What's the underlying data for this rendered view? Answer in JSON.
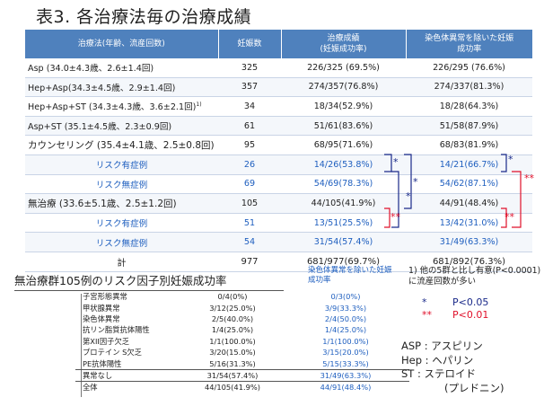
{
  "title": "表3. 各治療法毎の治療成績",
  "table": {
    "headers": [
      "治療法(年齢、流産回数)",
      "妊娠数",
      "治療成績\n(妊娠成功率)",
      "染色体異常を除いた妊娠成功率"
    ],
    "rows": [
      {
        "label": "Asp (34.0±4.3歳、2.6±1.4回)",
        "n": "325",
        "rate": "226/325 (69.5%)",
        "rate2": "226/295 (76.6%)",
        "sub": false
      },
      {
        "label": "Hep+Asp(34.3±4.5歳、2.9±1.4回)",
        "n": "357",
        "rate": "274/357(76.8%)",
        "rate2": "274/337(81.3%)",
        "sub": false
      },
      {
        "label": "Hep+Asp+ST (34.3±4.3歳、3.6±2.1回)",
        "sup": "1)",
        "n": "34",
        "rate": "18/34(52.9%)",
        "rate2": "18/28(64.3%)",
        "sub": false
      },
      {
        "label": "Asp+ST (35.1±4.5歳、2.3±0.9回)",
        "n": "61",
        "rate": "51/61(83.6%)",
        "rate2": "51/58(87.9%)",
        "sub": false
      },
      {
        "label": "カウンセリング (35.4±4.1歳、2.5±0.8回)",
        "n": "95",
        "rate": "68/95(71.6%)",
        "rate2": "68/83(81.9%)",
        "sub": false
      },
      {
        "label": "リスク有症例",
        "n": "26",
        "rate": "14/26(53.8%)",
        "rate2": "14/21(66.7%)",
        "sub": true
      },
      {
        "label": "リスク無症例",
        "n": "69",
        "rate": "54/69(78.3%)",
        "rate2": "54/62(87.1%)",
        "sub": true
      },
      {
        "label": "無治療 (33.6±5.1歳、2.5±1.2回)",
        "n": "105",
        "rate": "44/105(41.9%)",
        "rate2": "44/91(48.4%)",
        "sub": false
      },
      {
        "label": "リスク有症例",
        "n": "51",
        "rate": "13/51(25.5%)",
        "rate2": "13/42(31.0%)",
        "sub": true
      },
      {
        "label": "リスク無症例",
        "n": "54",
        "rate": "31/54(57.4%)",
        "rate2": "31/49(63.3%)",
        "sub": true
      },
      {
        "label": "計",
        "n": "977",
        "rate": "681/977(69.7%)",
        "rate2": "681/892(76.3%)",
        "sub": false
      }
    ]
  },
  "marks": {
    "single": "*",
    "double": "**"
  },
  "risk": {
    "title": "無治療群105例のリスク因子別妊娠成功率",
    "chrom_header": "染色体異常を除いた妊娠成功率",
    "rows": [
      {
        "factor": "子宮形態異常",
        "v1": "0/4(0%)",
        "v2": "0/3(0%)"
      },
      {
        "factor": "甲状腺異常",
        "v1": "3/12(25.0%)",
        "v2": "3/9(33.3%)"
      },
      {
        "factor": "染色体異常",
        "v1": "2/5(40.0%)",
        "v2": "2/4(50.0%)"
      },
      {
        "factor": "抗リン脂質抗体陽性",
        "v1": "1/4(25.0%)",
        "v2": "1/4(25.0%)"
      },
      {
        "factor": "第XII因子欠乏",
        "v1": "1/1(100.0%)",
        "v2": "1/1(100.0%)"
      },
      {
        "factor": "プロテイン S欠乏",
        "v1": "3/20(15.0%)",
        "v2": "3/15(20.0%)"
      },
      {
        "factor": "PE抗体陽性",
        "v1": "5/16(31.3%)",
        "v2": "5/15(33.3%)"
      },
      {
        "factor": "異常なし",
        "v1": "31/54(57.4%)",
        "v2": "31/49(63.3%)"
      },
      {
        "factor": "全体",
        "v1": "44/105(41.9%)",
        "v2": "44/91(48.4%)"
      }
    ]
  },
  "notes": {
    "footnote": "1) 他の5群と比し有意(P<0.0001)に流産回数が多い",
    "sig1_star": "*",
    "sig1_text": "P<0.05",
    "sig2_star": "**",
    "sig2_text": "P<0.01",
    "abbr": [
      "ASP : アスピリン",
      "Hep : ヘパリン",
      "ST : ステロイド",
      "(プレドニン)"
    ]
  },
  "colors": {
    "header_bg": "#4f81bd",
    "sub_text": "#1f5fbf",
    "bracket_blue": "#1a2a8a",
    "bracket_red": "#e0102a"
  }
}
